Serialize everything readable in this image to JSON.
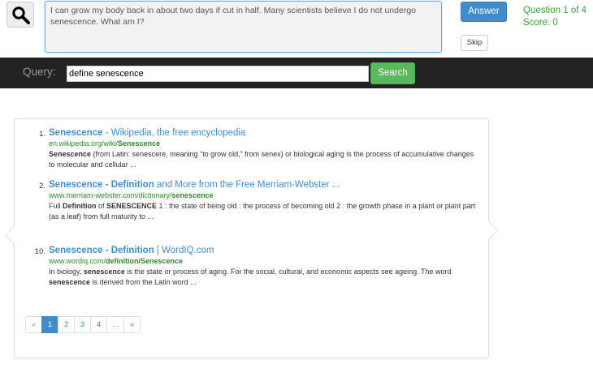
{
  "header": {
    "question": "I can grow my body back in about two days if cut in half. Many scientists believe I do not undergo senescence. What am I?",
    "answer_label": "Answer",
    "skip_label": "Skip",
    "question_progress": "Question 1 of 4",
    "score": "Score: 0"
  },
  "query": {
    "label": "Query:",
    "value": "define senescence",
    "search_label": "Search"
  },
  "results": [
    {
      "num": "1.",
      "title_bold": "Senescence",
      "title_rest": " - Wikipedia, the free encyclopedia",
      "url_plain": "en.wikipedia.org/wiki/",
      "url_bold": "Senescence",
      "snippet_html": "<b>Senescence</b> (from Latin: senescere, meaning “to grow old,” from senex) or biological aging is the process of accumulative changes to molecular and cellular ..."
    },
    {
      "num": "2.",
      "title_bold": "Senescence - Definition",
      "title_rest": " and More from the Free Merriam-Webster ...",
      "url_plain": "www.merriam-webster.com/dictionary/",
      "url_bold": "senescence",
      "snippet_html": "Full <b>Definition</b> of <b>SENESCENCE</b> 1 : the state of being old : the process of becoming old 2 : the growth phase in a plant or plant part (as a leaf) from full maturity to ..."
    },
    {
      "num": "10.",
      "title_bold": "Senescence - Definition",
      "title_rest": " | WordIQ.com",
      "url_plain": "www.wordiq.com/",
      "url_bold": "definition/Senescence",
      "snippet_html": "In biology, <b>senescence</b> is the state or process of aging. For the social, cultural, and economic aspects see ageing. The word <b>senescence</b> is derived from the Latin word ..."
    }
  ],
  "pagination": {
    "prev": "«",
    "pages": [
      "1",
      "2",
      "3",
      "4"
    ],
    "ellipsis": "...",
    "next": "»",
    "active": "1"
  },
  "colors": {
    "accent": "#428bca",
    "success": "#5cb85c",
    "url_green": "#2a8a2a",
    "dark_bar": "#222222"
  },
  "icons": {
    "search": "magnifier-icon"
  }
}
